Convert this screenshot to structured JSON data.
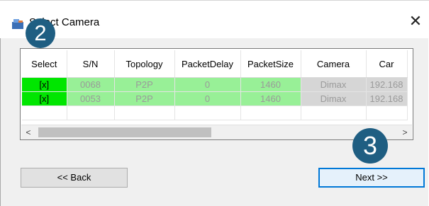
{
  "window": {
    "title": "Select Camera",
    "close_glyph": "✕",
    "app_icon": "camera-app-icon"
  },
  "annotations": {
    "step2": "2",
    "step3": "3"
  },
  "grid": {
    "columns": [
      "Select",
      "S/N",
      "Topology",
      "PacketDelay",
      "PacketSize",
      "Camera",
      "Car"
    ],
    "rows": [
      [
        "[x]",
        "0068",
        "P2P",
        "0",
        "1460",
        "Dimax",
        "192.168"
      ],
      [
        "[x]",
        "0053",
        "P2P",
        "0",
        "1460",
        "Dimax",
        "192.168"
      ]
    ]
  },
  "scrollbar": {
    "left_glyph": "<",
    "right_glyph": ">"
  },
  "buttons": {
    "back": "<< Back",
    "next": "Next >>"
  },
  "colors": {
    "select_cell": "#00e600",
    "row_green": "#98f097",
    "row_gray": "#d6d6d6",
    "badge": "#1f5e82",
    "focus_border": "#0078d7"
  }
}
